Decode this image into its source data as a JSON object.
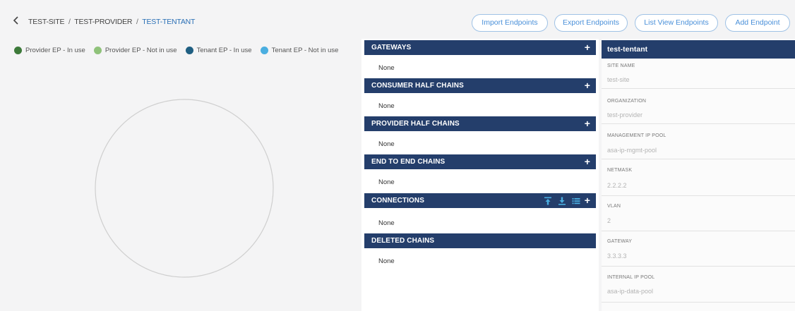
{
  "breadcrumb": {
    "site": "TEST-SITE",
    "provider": "TEST-PROVIDER",
    "tenant": "TEST-TENTANT",
    "separator": "/"
  },
  "toolbar": {
    "import_label": "Import Endpoints",
    "export_label": "Export Endpoints",
    "list_view_label": "List View Endpoints",
    "add_label": "Add Endpoint"
  },
  "legend": {
    "items": [
      {
        "label": "Provider EP - In use",
        "color": "#3d7a3a"
      },
      {
        "label": "Provider EP - Not in use",
        "color": "#8fc27a"
      },
      {
        "label": "Tenant EP - In use",
        "color": "#1f5f82"
      },
      {
        "label": "Tenant EP - Not in use",
        "color": "#4aaee0"
      }
    ]
  },
  "sections": [
    {
      "title": "GATEWAYS",
      "value": "None"
    },
    {
      "title": "CONSUMER HALF CHAINS",
      "value": "None"
    },
    {
      "title": "PROVIDER HALF CHAINS",
      "value": "None"
    },
    {
      "title": "END TO END CHAINS",
      "value": "None"
    },
    {
      "title": "CONNECTIONS",
      "value": "None"
    },
    {
      "title": "DELETED CHAINS",
      "value": "None"
    }
  ],
  "details": {
    "title": "test-tentant",
    "fields": [
      {
        "label": "SITE NAME",
        "value": "test-site"
      },
      {
        "label": "ORGANIZATION",
        "value": "test-provider"
      },
      {
        "label": "MANAGEMENT IP POOL",
        "value": "asa-ip-mgmt-pool"
      },
      {
        "label": "NETMASK",
        "value": "2.2.2.2"
      },
      {
        "label": "VLAN",
        "value": "2"
      },
      {
        "label": "GATEWAY",
        "value": "3.3.3.3"
      },
      {
        "label": "INTERNAL IP POOL",
        "value": "asa-ip-data-pool"
      }
    ]
  },
  "colors": {
    "header_bg": "#243e6b",
    "button_text": "#4a90d9",
    "button_border": "#9fc2e6",
    "link": "#2a6fb5"
  },
  "icons": {
    "back": "chevron-left-icon",
    "add": "plus-icon",
    "upload": "upload-icon",
    "download": "download-icon",
    "list": "list-icon"
  }
}
